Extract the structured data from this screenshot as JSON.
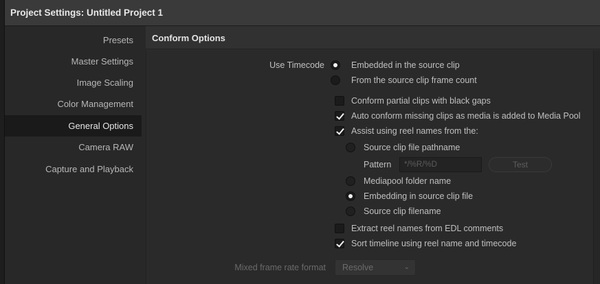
{
  "window": {
    "title": "Project Settings:  Untitled Project 1"
  },
  "sidebar": {
    "items": [
      {
        "label": "Presets"
      },
      {
        "label": "Master Settings"
      },
      {
        "label": "Image Scaling"
      },
      {
        "label": "Color Management"
      },
      {
        "label": "General Options"
      },
      {
        "label": "Camera RAW"
      },
      {
        "label": "Capture and Playback"
      }
    ],
    "active": "General Options"
  },
  "main": {
    "header": "Conform Options",
    "use_timecode": {
      "label": "Use Timecode",
      "options": [
        {
          "label": "Embedded in the source clip",
          "selected": true
        },
        {
          "label": "From the source clip frame count",
          "selected": false
        }
      ]
    },
    "checks": {
      "partial": {
        "label": "Conform partial clips with black gaps",
        "checked": false
      },
      "auto": {
        "label": "Auto conform missing clips as media is added to Media Pool",
        "checked": true
      },
      "assist": {
        "label": "Assist using reel names from the:",
        "checked": true
      }
    },
    "reel_source": {
      "options": [
        {
          "label": "Source clip file pathname",
          "selected": false
        },
        {
          "label": "Mediapool folder name",
          "selected": false
        },
        {
          "label": "Embedding in source clip file",
          "selected": true
        },
        {
          "label": "Source clip filename",
          "selected": false
        }
      ],
      "pattern_label": "Pattern",
      "pattern_value": "*/%R/%D",
      "test_button": "Test"
    },
    "extract": {
      "label": "Extract reel names from EDL comments",
      "checked": false
    },
    "sort": {
      "label": "Sort timeline using reel name and timecode",
      "checked": true
    },
    "mixed_rate": {
      "label": "Mixed frame rate format",
      "value": "Resolve",
      "icon": "chevron-down-icon"
    }
  }
}
